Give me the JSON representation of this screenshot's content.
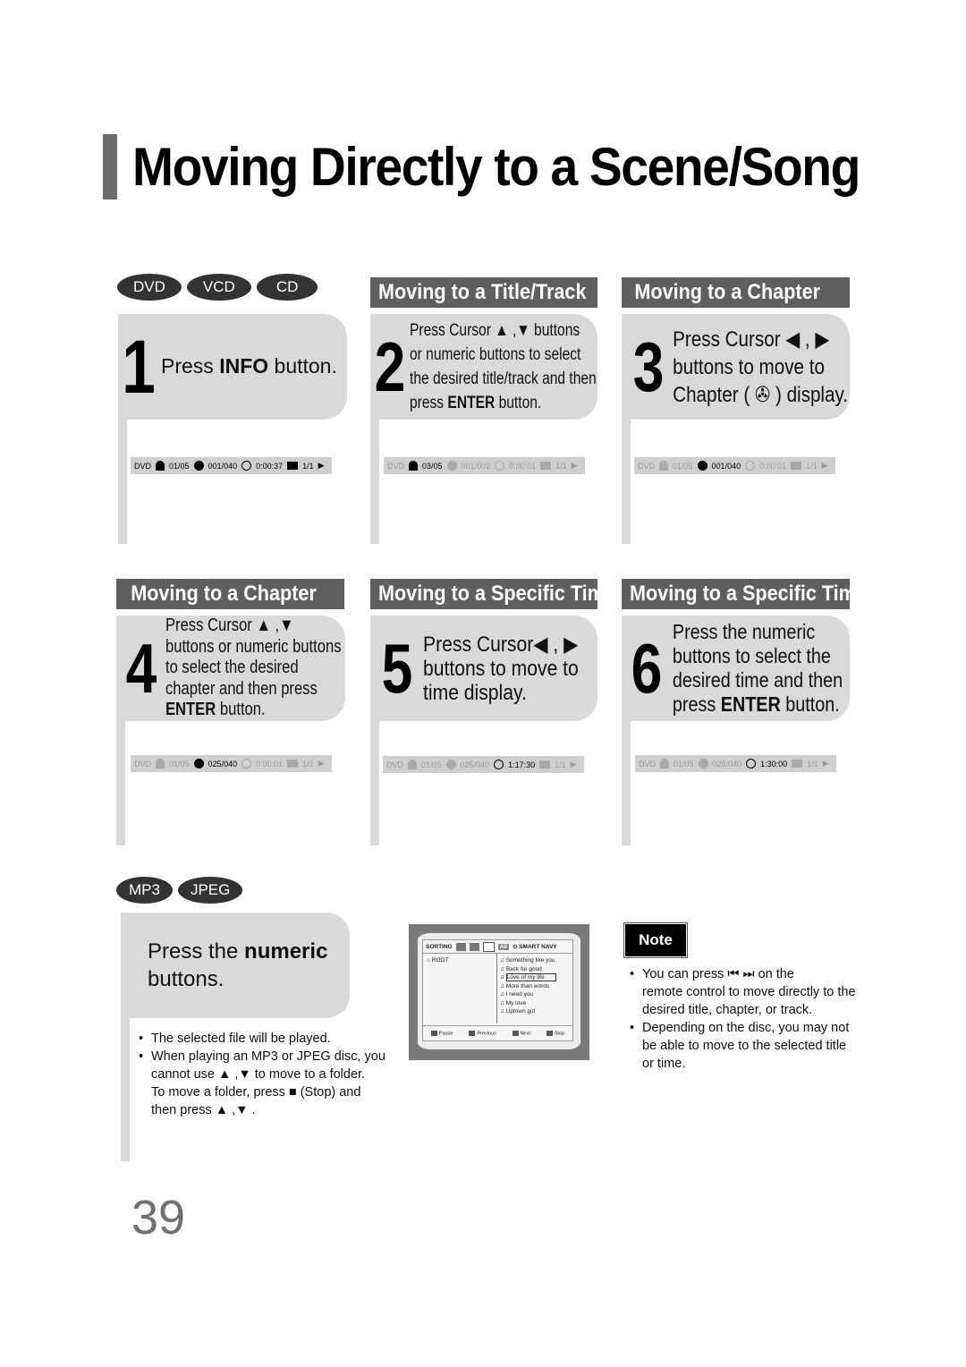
{
  "page": {
    "title": "Moving Directly to a Scene/Song",
    "page_number": "39"
  },
  "disc_badges": [
    "DVD",
    "VCD",
    "CD"
  ],
  "file_badges": [
    "MP3",
    "JPEG"
  ],
  "sections": {
    "title_track": "Moving to a Title/Track",
    "chapter_a": "Moving to a Chapter",
    "chapter_b": "Moving to a Chapter",
    "time_a": "Moving to a Specific Time",
    "time_b": "Moving to a Specific Time"
  },
  "steps": [
    {
      "num": "1",
      "pre": "Press ",
      "bold": "INFO",
      "post": " button."
    },
    {
      "num": "2",
      "line1": "Press Cursor ▲ ,▼  buttons",
      "line2": "or numeric buttons to select",
      "line3": "the desired title/track and then",
      "pre4": "press ",
      "bold4": "ENTER",
      "post4": " button."
    },
    {
      "num": "3",
      "line1": "Press Cursor ◀ , ▶",
      "line2": "buttons to move to",
      "line3": "Chapter ( ✇ ) display."
    },
    {
      "num": "4",
      "line1": "Press Cursor ▲ ,▼",
      "line2": "buttons or numeric buttons",
      "line3": "to select the desired",
      "line4": "chapter and then press",
      "bold5": "ENTER",
      "post5": " button."
    },
    {
      "num": "5",
      "line1": "Press Cursor◀ , ▶",
      "line2": "buttons to move to",
      "line3": "time display."
    },
    {
      "num": "6",
      "line1": "Press the numeric",
      "line2": "buttons to select the",
      "line3": "desired time and then",
      "pre4": "press ",
      "bold4": "ENTER",
      "post4": " button."
    }
  ],
  "osd": [
    {
      "disc": "DVD",
      "title": "01/05",
      "chapter": "001/040",
      "time": "0:00:37",
      "angle": "1/1",
      "active": "all"
    },
    {
      "disc": "DVD",
      "title": "03/05",
      "chapter": "001/002",
      "time": "0:00:01",
      "angle": "1/1",
      "active": "title"
    },
    {
      "disc": "DVD",
      "title": "01/05",
      "chapter": "001/040",
      "time": "0:00:01",
      "angle": "1/1",
      "active": "chapter"
    },
    {
      "disc": "DVD",
      "title": "01/05",
      "chapter": "025/040",
      "time": "0:00:01",
      "angle": "1/1",
      "active": "chapter"
    },
    {
      "disc": "DVD",
      "title": "01/05",
      "chapter": "025/040",
      "time": "1:17:30",
      "angle": "1/1",
      "active": "time"
    },
    {
      "disc": "DVD",
      "title": "01/05",
      "chapter": "028/040",
      "time": "1:30:00",
      "angle": "1/1",
      "active": "time"
    }
  ],
  "mp3": {
    "pre": "Press the ",
    "bold": "numeric",
    "post": "buttons.",
    "bullets": [
      "The selected file will be played.",
      "When playing an MP3 or JPEG disc, you",
      "cannot use  ▲ ,▼  to move to a folder.",
      "To move a folder, press ■ (Stop) and",
      "then press  ▲ ,▼ ."
    ]
  },
  "screen": {
    "sorting": "SORTING",
    "all": "All",
    "smart_navy": "⊙ SMART NAVY",
    "root": "ROOT",
    "tracks": [
      "Something like you",
      "Back for good",
      "Love of my life",
      "More than words",
      "I need you",
      "My love",
      "Uptown girl"
    ],
    "selected_index": 2,
    "footer": [
      "Pause",
      "Previous",
      "Next",
      "Stop"
    ]
  },
  "note": {
    "label": "Note",
    "lines": [
      "You can press ⏮ ⏭  on the",
      "remote control to move directly to the",
      "desired title, chapter, or track.",
      "Depending on the disc, you may not",
      "be able to move to the selected title",
      "or time."
    ]
  }
}
